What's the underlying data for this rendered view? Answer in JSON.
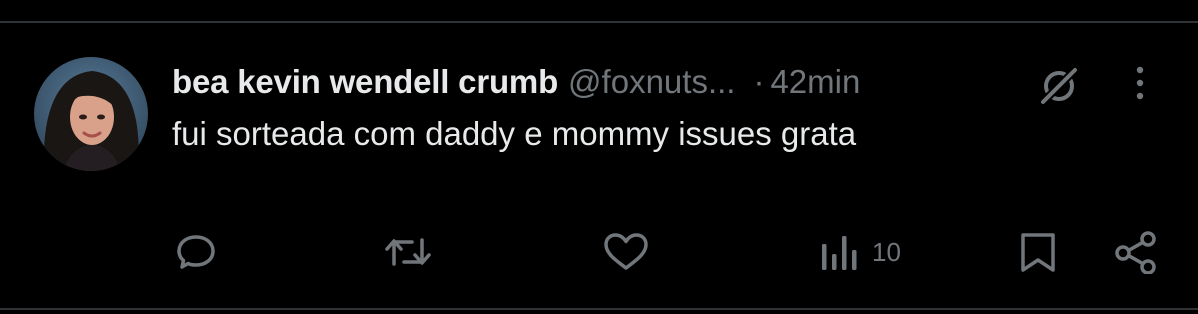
{
  "tweet": {
    "author": {
      "display_name": "bea kevin wendell crumb",
      "handle": "@foxnuts...",
      "avatar_icon": "profile-photo"
    },
    "separator": "·",
    "time": "42min",
    "text": "fui sorteada com daddy e mommy issues grata"
  },
  "actions": {
    "reply_icon": "speech-bubble-icon",
    "retweet_icon": "retweet-arrows-icon",
    "like_icon": "heart-icon",
    "views_icon": "bar-chart-icon",
    "views_count": "10",
    "bookmark_icon": "bookmark-icon",
    "share_icon": "share-icon"
  },
  "header_icons": {
    "grok": "grok-slash-circle-icon",
    "more": "vertical-ellipsis-icon"
  },
  "colors": {
    "background": "#000000",
    "text_primary": "#e7e9ea",
    "text_secondary": "#71767b",
    "divider": "#2f3336"
  }
}
